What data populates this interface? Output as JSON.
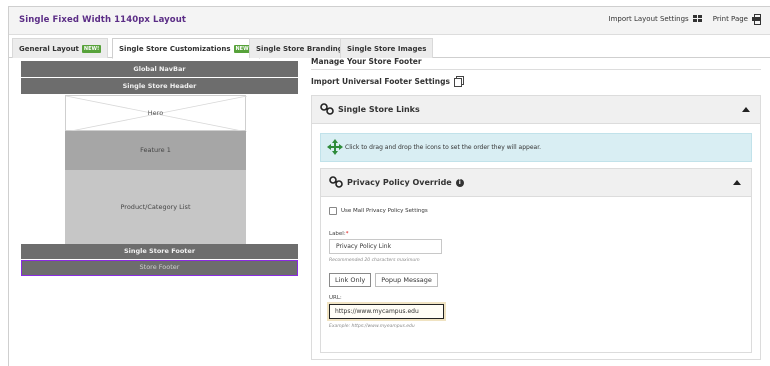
{
  "window": {
    "title": "Single Fixed Width 1140px Layout",
    "import_label": "Import Layout Settings",
    "print_label": "Print Page"
  },
  "tabs": [
    {
      "label": "General Layout",
      "badge": "NEW!",
      "active": false
    },
    {
      "label": "Single Store Customizations",
      "badge": "NEW!",
      "active": true
    },
    {
      "label": "Single Store Branding",
      "active": false
    },
    {
      "label": "Single Store Images",
      "active": false
    }
  ],
  "preview": {
    "nav": "Global NavBar",
    "header": "Single Store Header",
    "hero": "Hero",
    "feature": "Feature 1",
    "product": "Product/Category List",
    "single_footer": "Single Store Footer",
    "store_footer": "Store Footer"
  },
  "main": {
    "heading": "Manage Your Store Footer",
    "import_universal": "Import Universal Footer Settings",
    "links_panel": {
      "title": "Single Store Links",
      "info_text": "Click to drag and drop the icons to set the order they will appear.",
      "privacy": {
        "title": "Privacy Policy Override",
        "checkbox_label": "Use Mall Privacy Policy Settings",
        "label_field_label": "Label:",
        "label_required": "*",
        "label_value": "Privacy Policy Link",
        "label_hint": "Recommended 20 characters maximum",
        "mode_buttons": [
          "Link Only",
          "Popup Message"
        ],
        "url_label": "URL:",
        "url_value": "https://www.mycampus.edu",
        "url_hint": "Example: https://www.myeampus.edu"
      }
    }
  },
  "colors": {
    "title_purple": "#5b2d86",
    "new_badge_green": "#57a23a",
    "selected_outline": "#8a2be2",
    "info_bg": "#d9eef3"
  }
}
